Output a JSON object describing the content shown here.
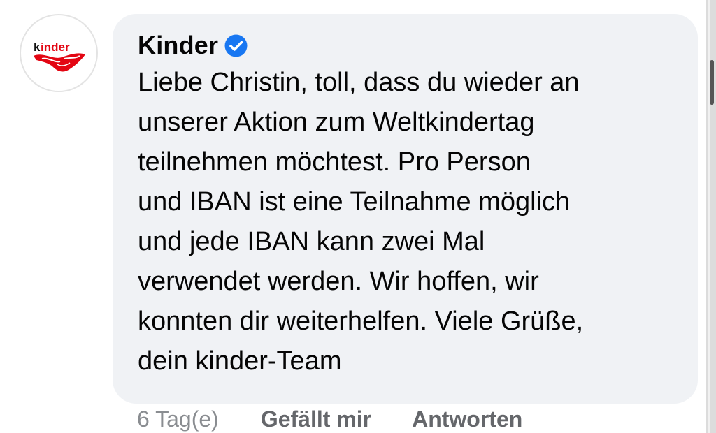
{
  "comment": {
    "author": "Kinder",
    "verified": true,
    "avatar_logo_text": "kinder",
    "text": "Liebe Christin, toll, dass du wieder an\nunserer Aktion zum Weltkindertag\nteilnehmen möchtest. Pro Person\nund IBAN ist eine Teilnahme möglich\nund jede IBAN kann zwei Mal\nverwendet werden. Wir hoffen, wir\nkonnten dir weiterhelfen. Viele Grüße,\ndein kinder-Team"
  },
  "actions": {
    "timestamp": "6 Tag(e)",
    "like_label": "Gefällt mir",
    "reply_label": "Antworten"
  },
  "colors": {
    "bubble": "#f0f2f5",
    "verified_badge": "#1877f2",
    "kinder_red": "#e30613",
    "action_text": "#65676b"
  }
}
